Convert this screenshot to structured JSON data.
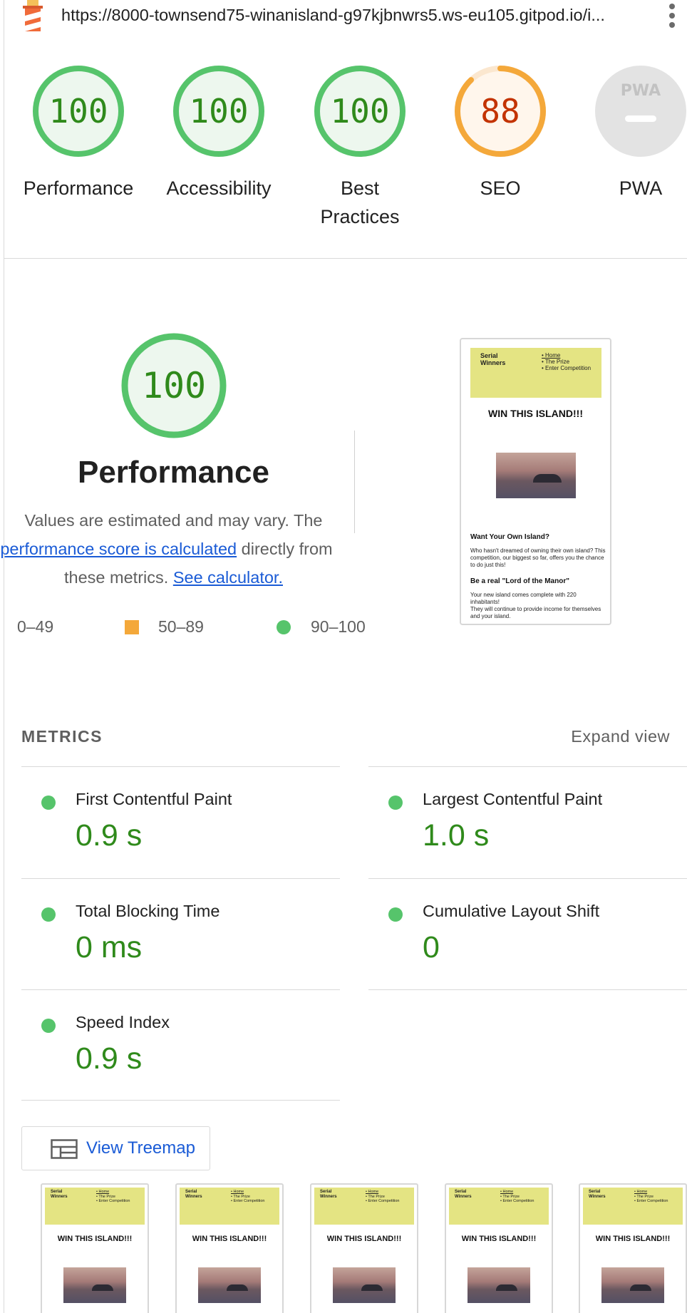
{
  "browser": {
    "url": "https://8000-townsend75-winanisland-g97kjbnwrs5.ws-eu105.gitpod.io/i..."
  },
  "categories": [
    {
      "score": "100",
      "label": "Performance",
      "status": "pass"
    },
    {
      "score": "100",
      "label": "Accessibility",
      "status": "pass"
    },
    {
      "score": "100",
      "label": "Best Practices",
      "status": "pass"
    },
    {
      "score": "88",
      "label": "SEO",
      "status": "average"
    },
    {
      "score": "",
      "label": "PWA",
      "status": "na",
      "badge_text": "PWA"
    }
  ],
  "score_fractions": [
    1.0,
    1.0,
    1.0,
    0.88,
    0
  ],
  "performance": {
    "score": "100",
    "score_fraction": 1.0,
    "title": "Performance",
    "desc_1": "Values are estimated and may vary. The",
    "desc_link": "performance score is calculated",
    "desc_2": "directly from",
    "desc_3": "these metrics.",
    "calc_link": "See calculator."
  },
  "legend": {
    "fail": "0–49",
    "average": "50–89",
    "pass": "90–100"
  },
  "page_preview": {
    "brand_line_1": "Serial",
    "brand_line_2": "Winners",
    "nav": [
      "Home",
      "The Prize",
      "Enter Competition"
    ],
    "heading": "WIN THIS ISLAND!!!",
    "section_1_title": "Want Your Own Island?",
    "section_1_text": "Who hasn't dreamed of owning their own island? This competition, our biggest so far, offers you the chance to do just this!",
    "section_2_title": "Be a real \"Lord of the Manor\"",
    "section_2_text_1": "Your new island comes complete with 220 inhabitants!",
    "section_2_text_2": "They will continue to provide income for themselves and your island."
  },
  "metrics": {
    "title": "METRICS",
    "expand": "Expand view",
    "items": [
      {
        "name": "First Contentful Paint",
        "value": "0.9 s"
      },
      {
        "name": "Largest Contentful Paint",
        "value": "1.0 s"
      },
      {
        "name": "Total Blocking Time",
        "value": "0 ms"
      },
      {
        "name": "Cumulative Layout Shift",
        "value": "0"
      },
      {
        "name": "Speed Index",
        "value": "0.9 s"
      }
    ]
  },
  "treemap": {
    "label": "View Treemap"
  },
  "colors": {
    "pass": "#56c46b",
    "pass_text": "#2f8a1b",
    "average": "#f4a83a",
    "average_text": "#c33300",
    "link": "#1a5bd6",
    "preview_header": "#e4e483"
  }
}
